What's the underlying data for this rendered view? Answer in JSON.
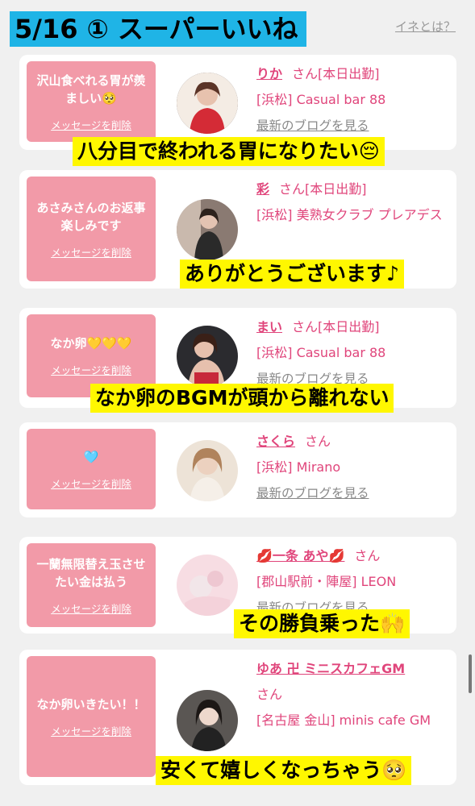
{
  "header": {
    "title_overlay": "5/16 ① スーパーいいね",
    "link": "イネとは？"
  },
  "cards": [
    {
      "message": "沢山食べれる胃が羨ましい🥺",
      "delete_label": "メッセージを削除",
      "name": "りか",
      "san": "さん[本日出勤]",
      "shop": "[浜松] Casual bar 88",
      "blog": "最新のブログを見る",
      "overlay": "八分目で終われる胃になりたい😔"
    },
    {
      "message": "あさみさんのお返事楽しみです",
      "delete_label": "メッセージを削除",
      "name": "彩",
      "san": "さん[本日出勤]",
      "shop": "[浜松] 美熟女クラブ プレアデス",
      "blog": "",
      "overlay": "ありがとうございます♪"
    },
    {
      "message": "なか卵💛💛💛",
      "delete_label": "メッセージを削除",
      "name": "まい",
      "san": "さん[本日出勤]",
      "shop": "[浜松] Casual bar 88",
      "blog": "最新のブログを見る",
      "overlay": "なか卵のBGMが頭から離れない"
    },
    {
      "message": "🩵",
      "delete_label": "メッセージを削除",
      "name": "さくら",
      "san": "さん",
      "shop": "[浜松] Mirano",
      "blog": "最新のブログを見る",
      "overlay": ""
    },
    {
      "message": "一蘭無限替え玉させたい金は払う",
      "delete_label": "メッセージを削除",
      "name": "💋一条 あや💋",
      "san": "さん",
      "shop": "[郡山駅前・陣屋] LEON",
      "blog": "最新のブログを見る",
      "overlay": "その勝負乗った🙌"
    },
    {
      "message": "なか卵いきたい！！",
      "delete_label": "メッセージを削除",
      "name": "ゆあ 卍 ミニスカフェGM",
      "san": "さん",
      "shop": "[名古屋 金山] minis cafe GM",
      "blog": "",
      "overlay": "安くて嬉しくなっちゃう🥺"
    }
  ],
  "colors": {
    "accent": "#e0457b",
    "message_box": "#f29aa8",
    "title_bg": "#1fb4e6",
    "overlay_bg": "#fff700"
  }
}
